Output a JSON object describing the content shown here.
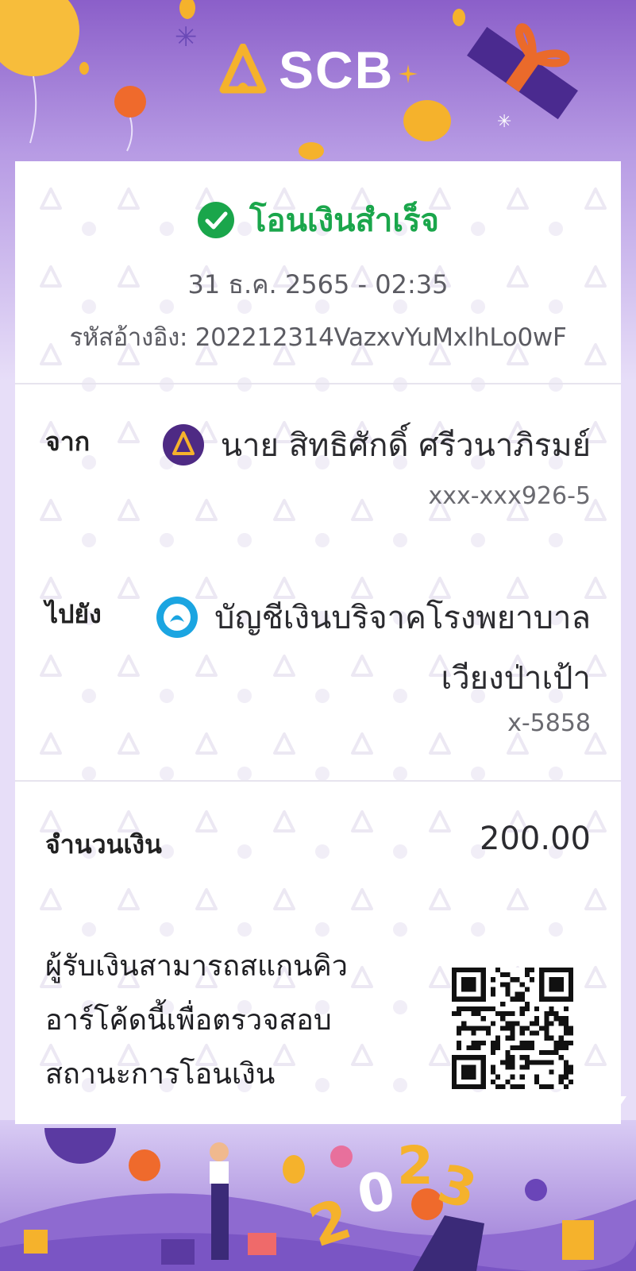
{
  "brand": {
    "name": "SCB",
    "color": "#4e2a84",
    "accent": "#f5b22c"
  },
  "transfer": {
    "status": "โอนเงินสำเร็จ",
    "status_color": "#1aa64b",
    "datetime": "31 ธ.ค. 2565 - 02:35",
    "reference": "รหัสอ้างอิง: 202212314VazxvYuMxlhLo0wF"
  },
  "from": {
    "label": "จาก",
    "bank_icon": "scb-logo-icon",
    "name": "นาย สิทธิศักดิ์ ศรีวนาภิรมย์",
    "account": "xxx-xxx926-5"
  },
  "to": {
    "label": "ไปยัง",
    "bank_icon": "krungthai-logo-icon",
    "name_line1": "บัญชีเงินบริจาคโรงพยาบาล",
    "name_line2": "เวียงป่าเป้า",
    "account": "x-5858"
  },
  "amount": {
    "label": "จำนวนเงิน",
    "value": "200.00"
  },
  "qr_note": {
    "line1": "ผู้รับเงินสามารถสแกนคิว",
    "line2": "อาร์โค้ดนี้เพื่อตรวจสอบ",
    "line3": "สถานะการโอนเงิน"
  },
  "decoration": {
    "year": "2023"
  }
}
